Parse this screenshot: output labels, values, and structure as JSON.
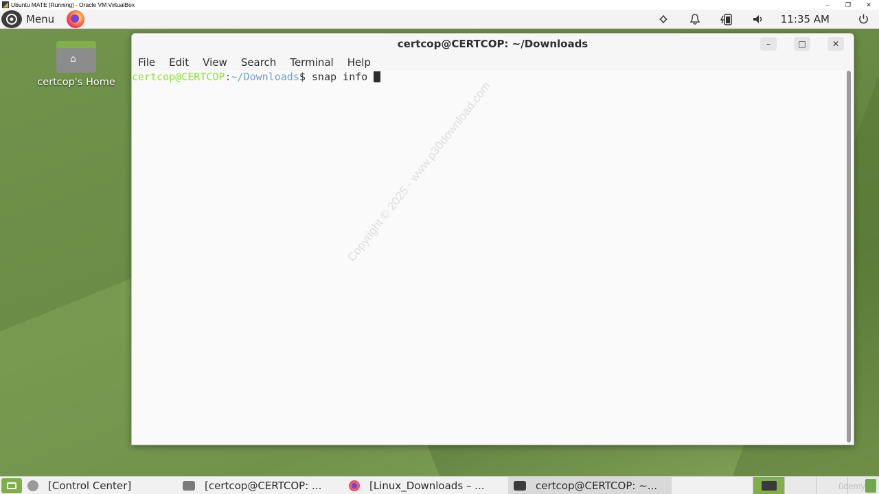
{
  "host_window": {
    "title": "Ubuntu MATE [Running] - Oracle VM VirtualBox",
    "controls": [
      "–",
      "❐",
      "✕"
    ]
  },
  "top_panel": {
    "menu_label": "Menu",
    "clock": "11:35 AM",
    "tray_icons": [
      "network-icon",
      "notification-bell-icon",
      "battery-icon",
      "volume-icon",
      "power-icon"
    ]
  },
  "desktop": {
    "home_icon_label": "certcop's Home"
  },
  "terminal": {
    "title": "certcop@CERTCOP: ~/Downloads",
    "menu": [
      "File",
      "Edit",
      "View",
      "Search",
      "Terminal",
      "Help"
    ],
    "prompt_user": "certcop@CERTCOP",
    "prompt_sep": ":",
    "prompt_path": "~/Downloads",
    "prompt_symbol": "$ ",
    "command": "snap info ",
    "watermark": "Copyright © 2025 - www.p30download.com"
  },
  "taskbar": {
    "tasks": [
      {
        "label": "[Control Center]",
        "icon": "control-center-icon"
      },
      {
        "label": "[certcop@CERTCOP: ...",
        "icon": "terminal-icon"
      },
      {
        "label": "[Linux_Downloads – ...",
        "icon": "firefox-icon"
      },
      {
        "label": "certcop@CERTCOP: ~...",
        "icon": "terminal-icon"
      }
    ],
    "watermark": "ûdemy"
  },
  "colors": {
    "desktop_green": "#6f8f4a",
    "prompt_user": "#8ae234",
    "prompt_path": "#729fcf",
    "accent_green": "#7fae4a"
  }
}
